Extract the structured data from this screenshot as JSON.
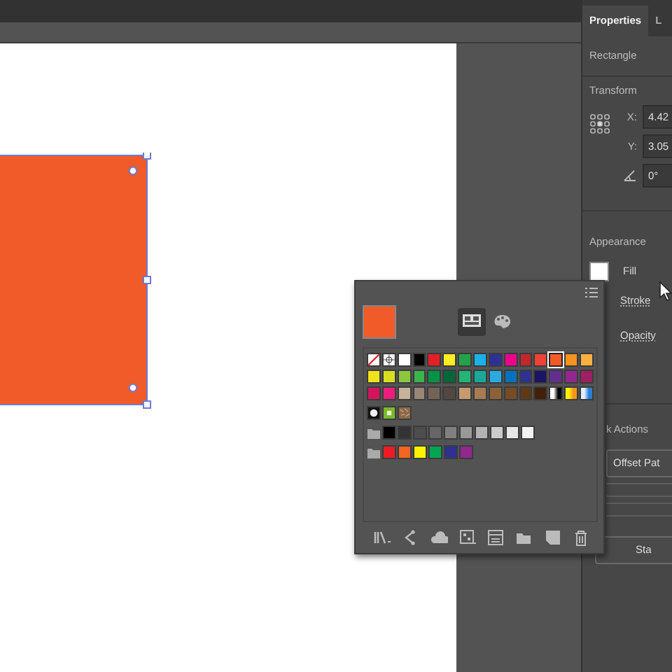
{
  "document": {
    "shape": {
      "selected": true
    }
  },
  "properties": {
    "tabs": [
      {
        "label": "Properties",
        "selected": true
      },
      {
        "label": "L",
        "selected": false
      }
    ],
    "object_type": "Rectangle",
    "transform": {
      "title": "Transform",
      "x_label": "X:",
      "x_value": "4.42",
      "y_label": "Y:",
      "y_value": "3.05",
      "angle_value": "0°"
    },
    "appearance": {
      "title": "Appearance",
      "fill_label": "Fill",
      "stroke_label": "Stroke",
      "opacity_label": "Opacity"
    },
    "quick_actions": {
      "title": "k Actions",
      "buttons": [
        "Offset Pat",
        "Sta"
      ]
    }
  },
  "swatches_panel": {
    "current_fill": {
      "color": "#f15a29"
    },
    "view_modes": [
      {
        "kind": "grid",
        "selected": true
      },
      {
        "kind": "palette",
        "selected": false
      }
    ],
    "rows": [
      {
        "folder": false,
        "swatches": [
          {
            "kind": "none",
            "selected": false
          },
          {
            "kind": "registration",
            "selected": false
          },
          {
            "kind": "solid",
            "color": "#ffffff",
            "selected": false
          },
          {
            "kind": "solid",
            "color": "#000000",
            "selected": false
          },
          {
            "kind": "solid",
            "color": "#e61e25",
            "selected": false
          },
          {
            "kind": "solid",
            "color": "#fcee21",
            "selected": false
          },
          {
            "kind": "solid",
            "color": "#22a34a",
            "selected": false
          },
          {
            "kind": "solid",
            "color": "#1ab1ea",
            "selected": false
          },
          {
            "kind": "solid",
            "color": "#2e3192",
            "selected": false
          },
          {
            "kind": "solid",
            "color": "#ec008c",
            "selected": false
          },
          {
            "kind": "solid",
            "color": "#c1272d",
            "selected": false
          },
          {
            "kind": "solid",
            "color": "#ef4136",
            "selected": false
          },
          {
            "kind": "solid",
            "color": "#f15a29",
            "selected": true
          },
          {
            "kind": "solid",
            "color": "#f7931e",
            "selected": false
          },
          {
            "kind": "solid",
            "color": "#fbb040",
            "selected": false
          }
        ]
      },
      {
        "folder": false,
        "swatches": [
          {
            "kind": "solid",
            "color": "#f0e21b",
            "selected": false
          },
          {
            "kind": "solid",
            "color": "#d9e021",
            "selected": false
          },
          {
            "kind": "solid",
            "color": "#8cc63f",
            "selected": false
          },
          {
            "kind": "solid",
            "color": "#39b54a",
            "selected": false
          },
          {
            "kind": "solid",
            "color": "#009245",
            "selected": false
          },
          {
            "kind": "solid",
            "color": "#006837",
            "selected": false
          },
          {
            "kind": "solid",
            "color": "#22b573",
            "selected": false
          },
          {
            "kind": "solid",
            "color": "#1aa89a",
            "selected": false
          },
          {
            "kind": "solid",
            "color": "#29abe2",
            "selected": false
          },
          {
            "kind": "solid",
            "color": "#0071bc",
            "selected": false
          },
          {
            "kind": "solid",
            "color": "#2e3192",
            "selected": false
          },
          {
            "kind": "solid",
            "color": "#1b1464",
            "selected": false
          },
          {
            "kind": "solid",
            "color": "#662d91",
            "selected": false
          },
          {
            "kind": "solid",
            "color": "#93278f",
            "selected": false
          },
          {
            "kind": "solid",
            "color": "#9e1f63",
            "selected": false
          }
        ]
      },
      {
        "folder": false,
        "swatches": [
          {
            "kind": "solid",
            "color": "#d4145a",
            "selected": false
          },
          {
            "kind": "solid",
            "color": "#ed1e79",
            "selected": false
          },
          {
            "kind": "solid",
            "color": "#c7b299",
            "selected": false
          },
          {
            "kind": "solid",
            "color": "#998675",
            "selected": false
          },
          {
            "kind": "solid",
            "color": "#736357",
            "selected": false
          },
          {
            "kind": "solid",
            "color": "#534741",
            "selected": false
          },
          {
            "kind": "solid",
            "color": "#c69c6d",
            "selected": false
          },
          {
            "kind": "solid",
            "color": "#a67c52",
            "selected": false
          },
          {
            "kind": "solid",
            "color": "#8c6239",
            "selected": false
          },
          {
            "kind": "solid",
            "color": "#754c24",
            "selected": false
          },
          {
            "kind": "solid",
            "color": "#603813",
            "selected": false
          },
          {
            "kind": "solid",
            "color": "#42210b",
            "selected": false
          },
          {
            "kind": "gradient",
            "stops": [
              {
                "color": "#ffffff"
              },
              {
                "color": "#000000"
              }
            ],
            "selected": false
          },
          {
            "kind": "gradient",
            "stops": [
              {
                "color": "#fff200"
              },
              {
                "color": "#f7941d"
              }
            ],
            "selected": false
          },
          {
            "kind": "gradient",
            "stops": [
              {
                "color": "#e0f0ff"
              },
              {
                "color": "#2a7fd4"
              }
            ],
            "selected": false
          }
        ]
      },
      {
        "folder": false,
        "swatches": [
          {
            "kind": "dots",
            "selected": false
          },
          {
            "kind": "tiles",
            "selected": false
          },
          {
            "kind": "texture",
            "selected": false
          }
        ]
      },
      {
        "folder": true,
        "swatches": [
          {
            "kind": "solid",
            "color": "#000000",
            "selected": false
          },
          {
            "kind": "solid",
            "color": "#333333",
            "selected": false
          },
          {
            "kind": "solid",
            "color": "#4d4d4d",
            "selected": false
          },
          {
            "kind": "solid",
            "color": "#666666",
            "selected": false
          },
          {
            "kind": "solid",
            "color": "#808080",
            "selected": false
          },
          {
            "kind": "solid",
            "color": "#999999",
            "selected": false
          },
          {
            "kind": "solid",
            "color": "#b3b3b3",
            "selected": false
          },
          {
            "kind": "solid",
            "color": "#cccccc",
            "selected": false
          },
          {
            "kind": "solid",
            "color": "#e6e6e6",
            "selected": false
          },
          {
            "kind": "solid",
            "color": "#f2f2f2",
            "selected": false
          }
        ]
      },
      {
        "folder": true,
        "swatches": [
          {
            "kind": "solid",
            "color": "#ed1c24",
            "selected": false
          },
          {
            "kind": "solid",
            "color": "#f26522",
            "selected": false
          },
          {
            "kind": "solid",
            "color": "#fff200",
            "selected": false
          },
          {
            "kind": "solid",
            "color": "#00a651",
            "selected": false
          },
          {
            "kind": "solid",
            "color": "#2e3192",
            "selected": false
          },
          {
            "kind": "solid",
            "color": "#92278f",
            "selected": false
          }
        ]
      }
    ]
  }
}
